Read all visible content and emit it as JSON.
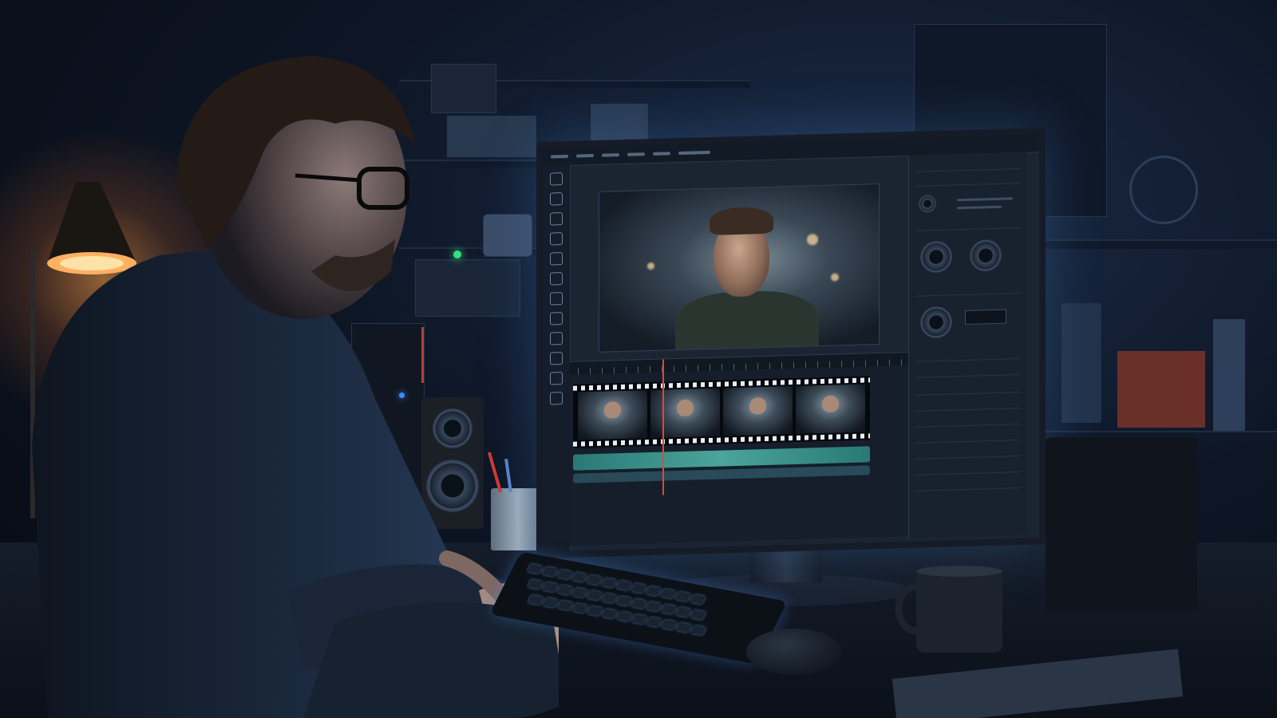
{
  "scene": {
    "description_free": true
  },
  "colors": {
    "ambient": "#0e1626",
    "lamp": "#ffa046",
    "screen_glow": "#5096e6",
    "playhead": "#e0463a",
    "audio_track": "#58c7b8"
  },
  "icons": {
    "lamp": "desk-lamp-icon",
    "monitor": "monitor-icon",
    "keyboard": "keyboard-icon",
    "mouse": "mouse-icon",
    "mug": "mug-icon"
  }
}
